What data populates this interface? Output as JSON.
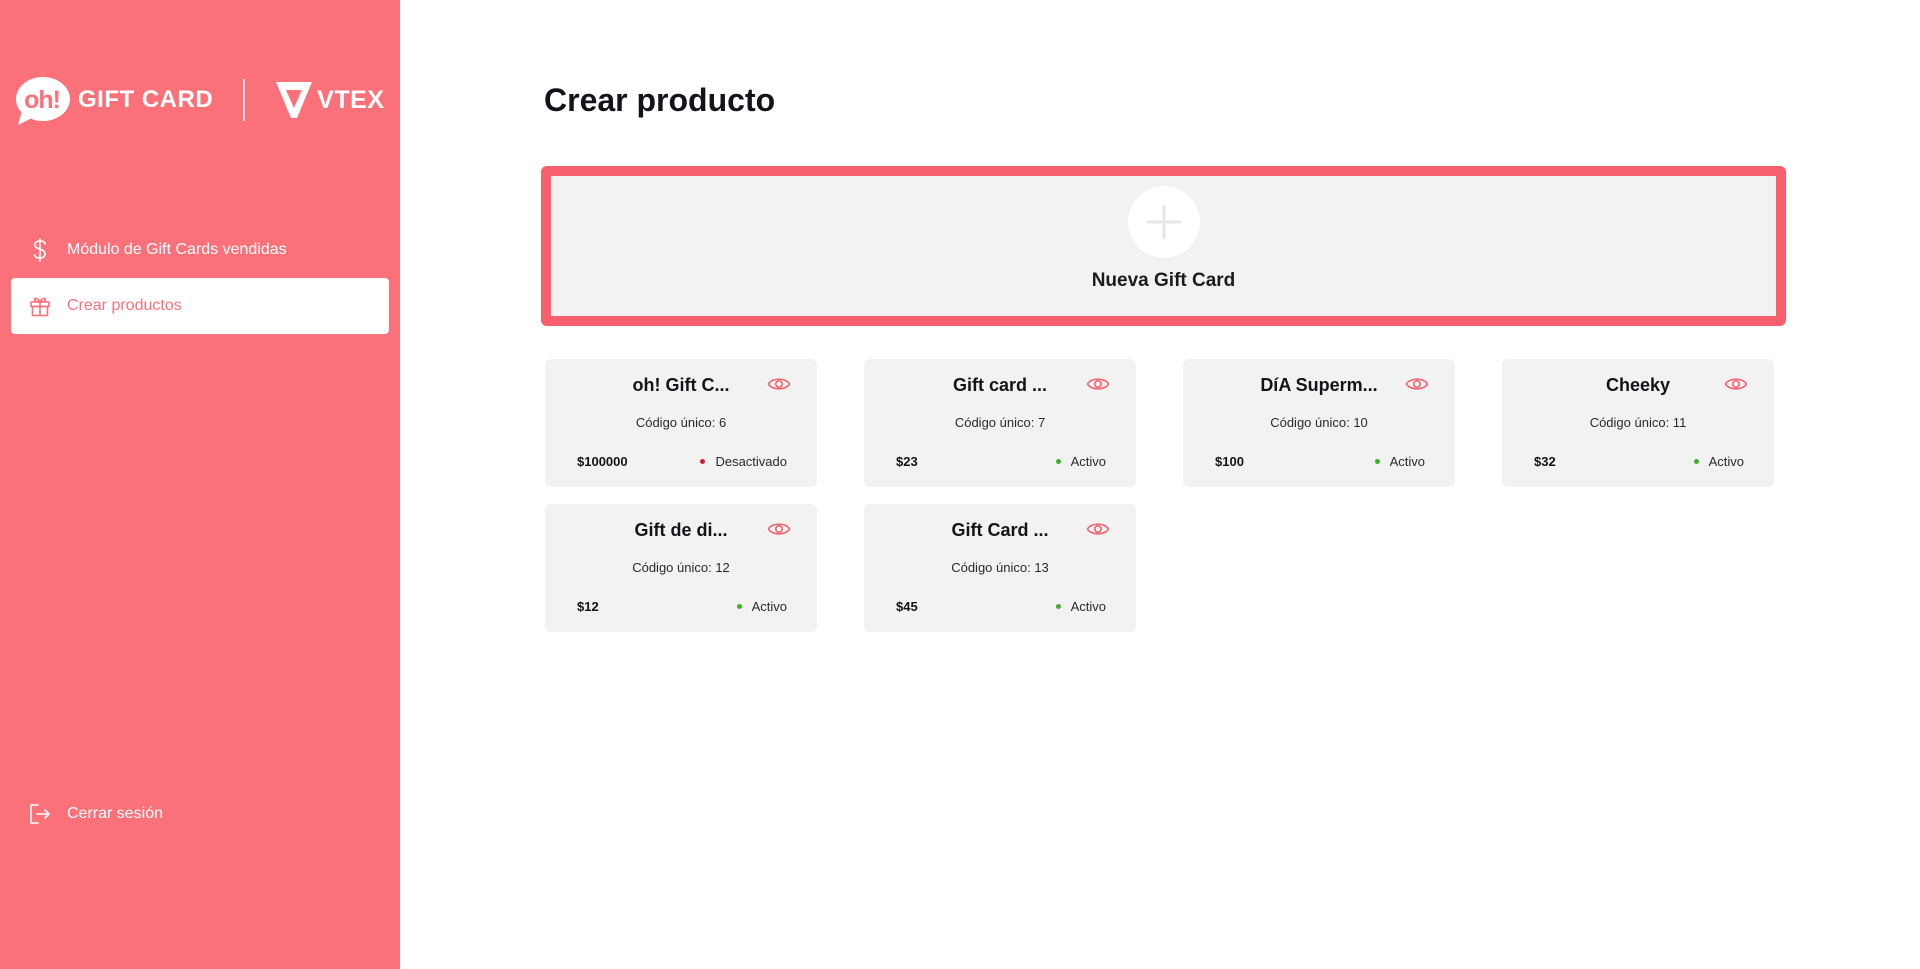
{
  "brand": {
    "oh_text": "oh!",
    "gift_card_text": "GIFT CARD",
    "vtex_text": "VTEX"
  },
  "sidebar": {
    "items": [
      {
        "label": "Módulo de Gift Cards vendidas",
        "icon": "dollar-icon",
        "active": false
      },
      {
        "label": "Crear productos",
        "icon": "gift-icon",
        "active": true
      }
    ],
    "logout_label": "Cerrar sesión"
  },
  "main": {
    "title": "Crear producto",
    "new_card_label": "Nueva Gift Card",
    "cards": [
      {
        "title": "oh! Gift C...",
        "code": "Código único: 6",
        "price": "$100000",
        "status": "Desactivado",
        "status_color": "#d21f2b"
      },
      {
        "title": "Gift card ...",
        "code": "Código único: 7",
        "price": "$23",
        "status": "Activo",
        "status_color": "#3fae2a"
      },
      {
        "title": "DíA Superm...",
        "code": "Código único: 10",
        "price": "$100",
        "status": "Activo",
        "status_color": "#3fae2a"
      },
      {
        "title": "Cheeky",
        "code": "Código único: 11",
        "price": "$32",
        "status": "Activo",
        "status_color": "#3fae2a"
      },
      {
        "title": "Gift de di...",
        "code": "Código único: 12",
        "price": "$12",
        "status": "Activo",
        "status_color": "#3fae2a"
      },
      {
        "title": "Gift Card ...",
        "code": "Código único: 13",
        "price": "$45",
        "status": "Activo",
        "status_color": "#3fae2a"
      }
    ]
  },
  "colors": {
    "sidebar_bg": "#fb717a",
    "accent_border": "#f65f6b",
    "card_bg": "#f2f2f2"
  }
}
